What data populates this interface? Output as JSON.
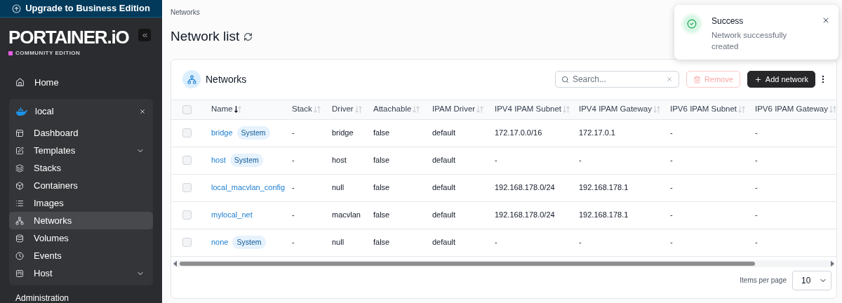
{
  "banner": {
    "label": "Upgrade to Business Edition"
  },
  "logo": {
    "name": "PORTAINER.iO",
    "edition": "COMMUNITY EDITION"
  },
  "sidebar": {
    "home": "Home",
    "environment": {
      "name": "local",
      "items": [
        {
          "label": "Dashboard",
          "selected": false,
          "has_submenu": false
        },
        {
          "label": "Templates",
          "selected": false,
          "has_submenu": true
        },
        {
          "label": "Stacks",
          "selected": false,
          "has_submenu": false
        },
        {
          "label": "Containers",
          "selected": false,
          "has_submenu": false
        },
        {
          "label": "Images",
          "selected": false,
          "has_submenu": false
        },
        {
          "label": "Networks",
          "selected": true,
          "has_submenu": false
        },
        {
          "label": "Volumes",
          "selected": false,
          "has_submenu": false
        },
        {
          "label": "Events",
          "selected": false,
          "has_submenu": false
        },
        {
          "label": "Host",
          "selected": false,
          "has_submenu": true
        }
      ]
    },
    "section": "Administration"
  },
  "breadcrumb": "Networks",
  "page_title": "Network list",
  "card": {
    "title": "Networks",
    "search": {
      "placeholder": "Search..."
    },
    "buttons": [
      {
        "kind": "remove",
        "label": "Remove",
        "disabled": true
      },
      {
        "kind": "add",
        "label": "Add network",
        "disabled": false
      }
    ],
    "table": {
      "select_all": {
        "checked": false
      },
      "columns": [
        {
          "label": "Name",
          "sorted": true
        },
        {
          "label": "Stack",
          "sorted": false
        },
        {
          "label": "Driver",
          "sorted": false
        },
        {
          "label": "Attachable",
          "sorted": false
        },
        {
          "label": "IPAM Driver",
          "sorted": false
        },
        {
          "label": "IPV4 IPAM Subnet",
          "sorted": false
        },
        {
          "label": "IPV4 IPAM Gateway",
          "sorted": false
        },
        {
          "label": "IPV6 IPAM Subnet",
          "sorted": false
        },
        {
          "label": "IPV6 IPAM Gateway",
          "sorted": false
        }
      ],
      "rows": [
        {
          "checked": false,
          "badge": "System",
          "cells": [
            "bridge",
            "-",
            "bridge",
            "false",
            "default",
            "172.17.0.0/16",
            "172.17.0.1",
            "-",
            "-"
          ]
        },
        {
          "checked": false,
          "badge": "System",
          "cells": [
            "host",
            "-",
            "host",
            "false",
            "default",
            "-",
            "-",
            "-",
            "-"
          ]
        },
        {
          "checked": false,
          "cells": [
            "local_macvlan_config",
            "-",
            "null",
            "false",
            "default",
            "192.168.178.0/24",
            "192.168.178.1",
            "-",
            "-"
          ]
        },
        {
          "checked": false,
          "cells": [
            "mylocal_net",
            "-",
            "macvlan",
            "false",
            "default",
            "192.168.178.0/24",
            "192.168.178.1",
            "-",
            "-"
          ]
        },
        {
          "checked": false,
          "badge": "System",
          "cells": [
            "none",
            "-",
            "null",
            "false",
            "default",
            "-",
            "-",
            "-",
            "-"
          ]
        }
      ]
    },
    "footer": {
      "label": "Items per page",
      "value": "10"
    }
  },
  "toast": {
    "title": "Success",
    "message": "Network successfully created"
  }
}
